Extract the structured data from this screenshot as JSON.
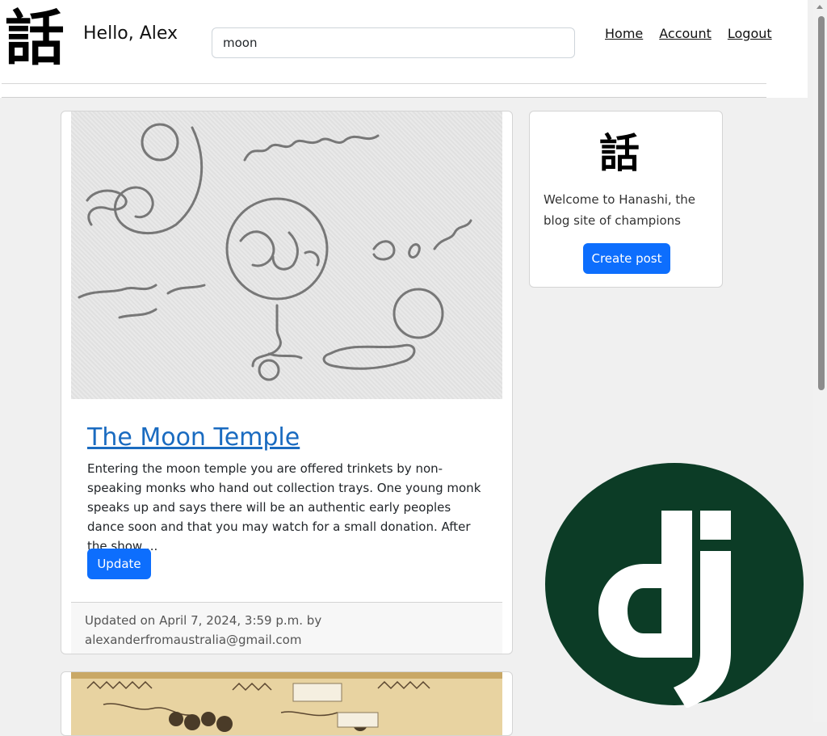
{
  "header": {
    "logo_glyph": "話",
    "greeting": "Hello, Alex",
    "search_value": "moon",
    "nav": {
      "home": "Home",
      "account": "Account",
      "logout": "Logout"
    }
  },
  "post": {
    "title": "The Moon Temple",
    "excerpt": "Entering the moon temple you are offered trinkets by non-speaking monks who hand out collection trays. One young monk speaks up and says there will be an authentic early peoples dance soon and that you may watch for a small donation. After the show ...",
    "update_label": "Update",
    "footer": "Updated on April 7, 2024, 3:59 p.m. by alexanderfromaustralia@gmail.com"
  },
  "sidebar": {
    "logo_glyph": "話",
    "welcome": "Welcome to Hanashi, the blog site of champions",
    "create_label": "Create post"
  },
  "colors": {
    "primary": "#0d6efd",
    "link": "#1a6bc0",
    "django_green": "#0c3c26",
    "page_bg": "#f0f0f0"
  }
}
